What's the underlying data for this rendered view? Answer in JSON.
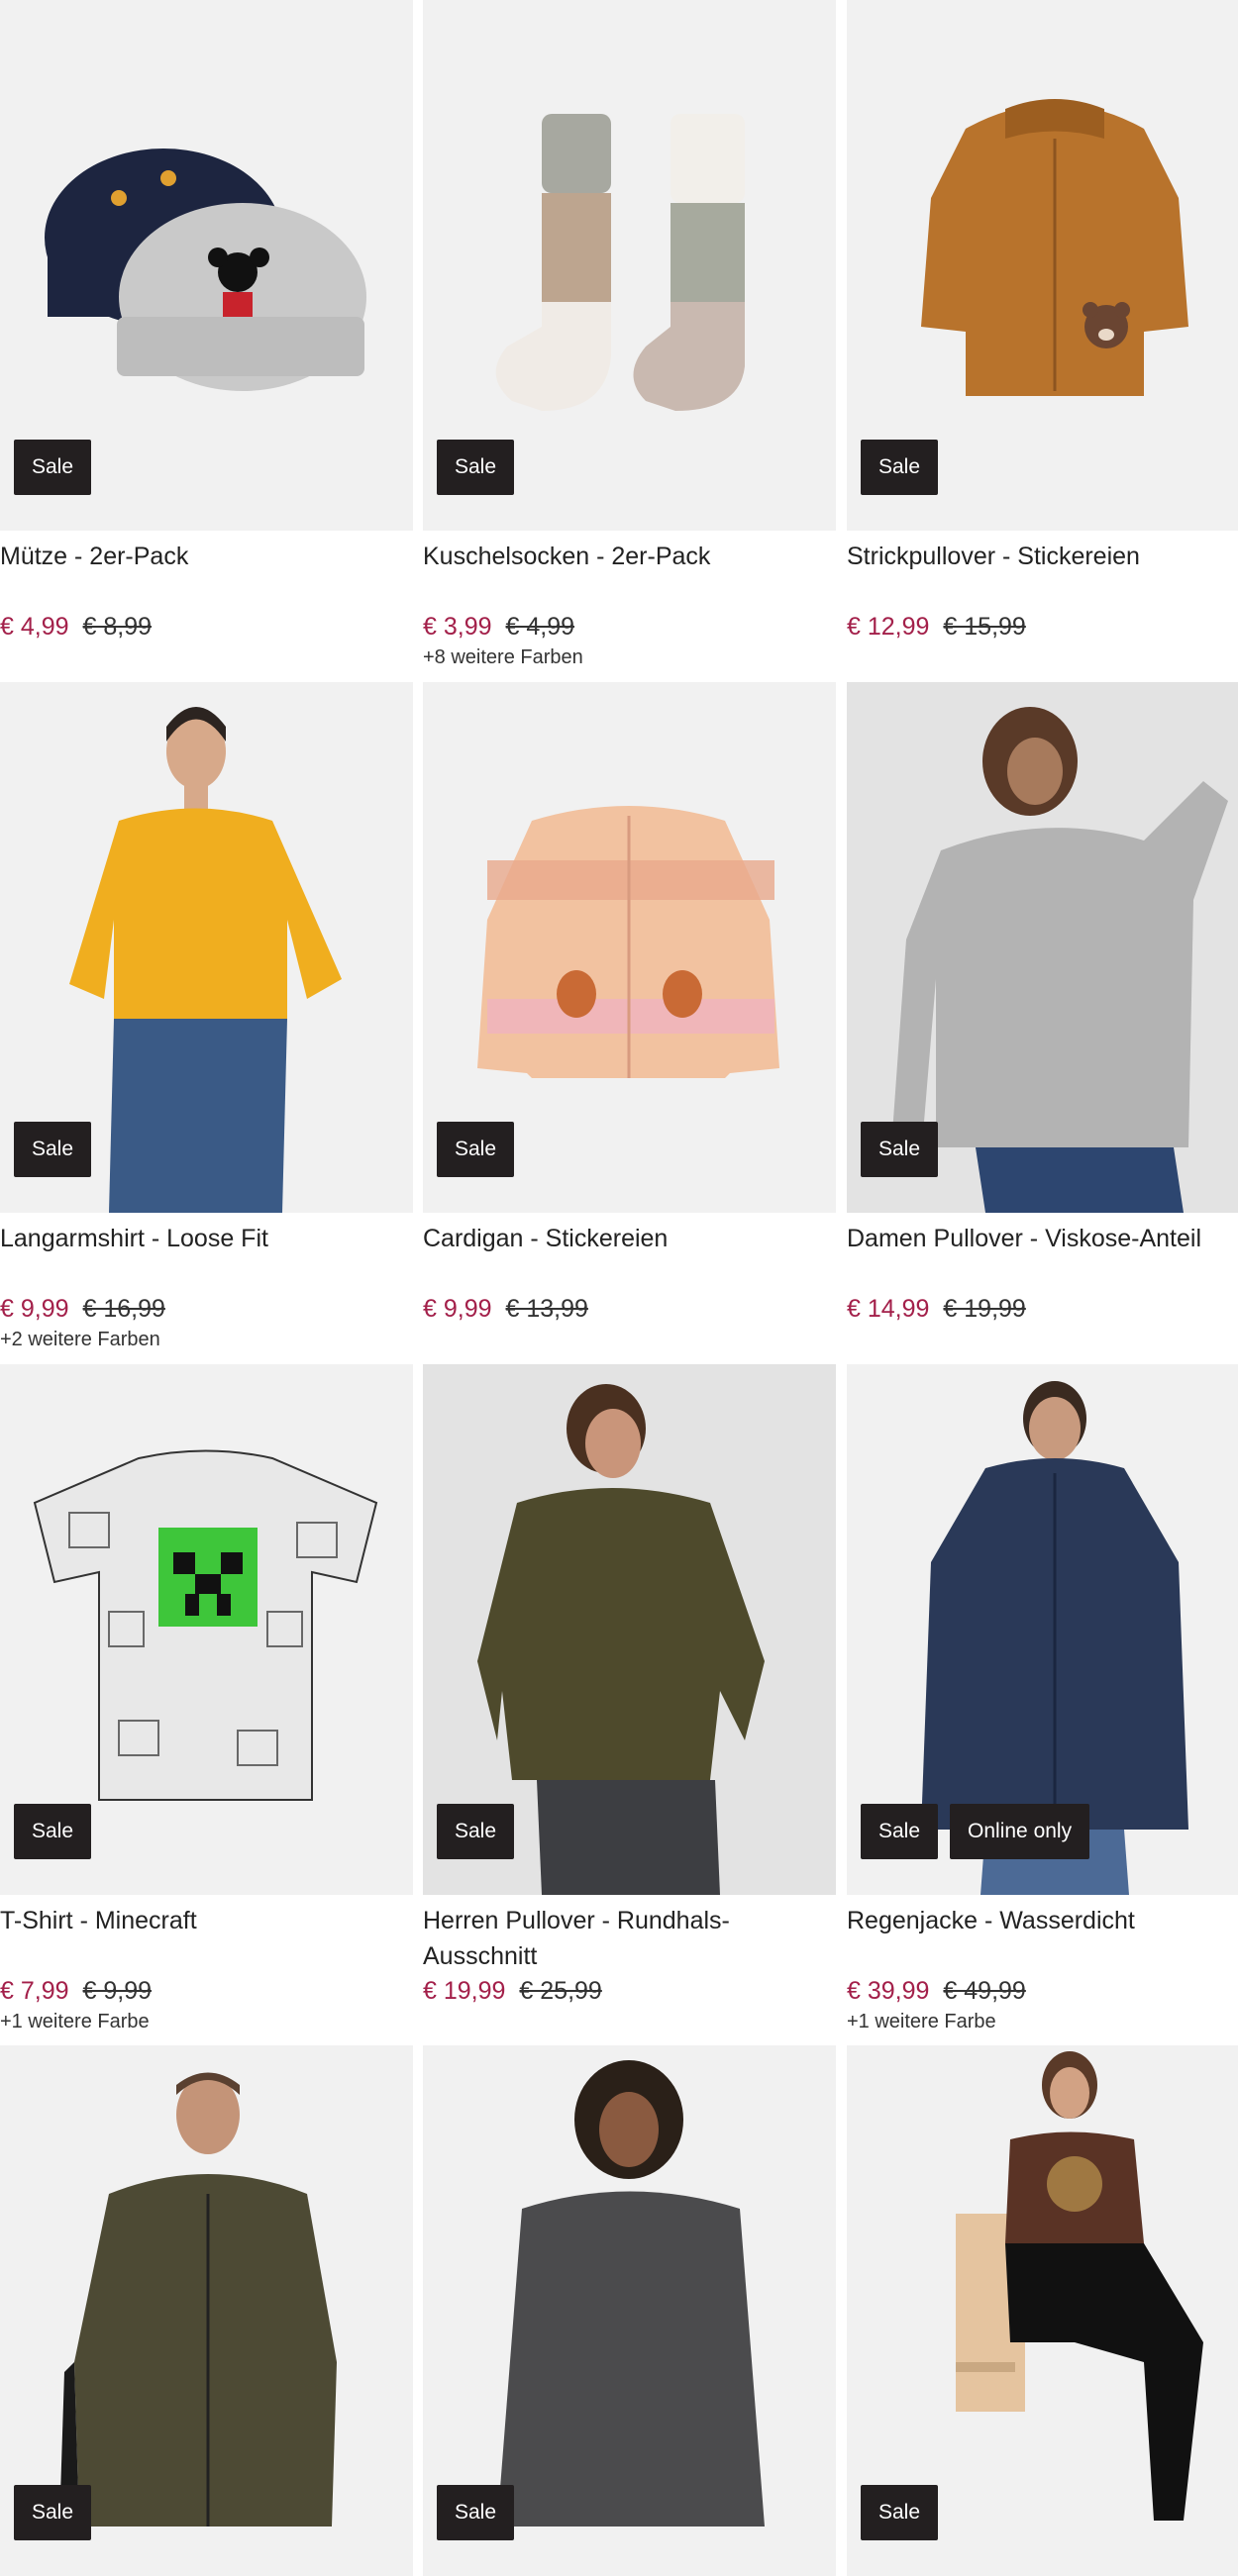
{
  "products": [
    {
      "name": "Mütze - 2er-Pack",
      "price": "€ 4,99",
      "old_price": "€ 8,99",
      "colors": "",
      "badges": [
        "Sale"
      ]
    },
    {
      "name": "Kuschelsocken - 2er-Pack",
      "price": "€ 3,99",
      "old_price": "€ 4,99",
      "colors": "+8 weitere Farben",
      "badges": [
        "Sale"
      ]
    },
    {
      "name": "Strickpullover - Stickereien",
      "price": "€ 12,99",
      "old_price": "€ 15,99",
      "colors": "",
      "badges": [
        "Sale"
      ]
    },
    {
      "name": "Langarmshirt - Loose Fit",
      "price": "€ 9,99",
      "old_price": "€ 16,99",
      "colors": "+2 weitere Farben",
      "badges": [
        "Sale"
      ]
    },
    {
      "name": "Cardigan - Stickereien",
      "price": "€ 9,99",
      "old_price": "€ 13,99",
      "colors": "",
      "badges": [
        "Sale"
      ]
    },
    {
      "name": "Damen Pullover - Viskose-Anteil",
      "price": "€ 14,99",
      "old_price": "€ 19,99",
      "colors": "",
      "badges": [
        "Sale"
      ]
    },
    {
      "name": "T-Shirt - Minecraft",
      "price": "€ 7,99",
      "old_price": "€ 9,99",
      "colors": "+1 weitere Farbe",
      "badges": [
        "Sale"
      ]
    },
    {
      "name": "Herren Pullover - Rundhals-Ausschnitt",
      "price": "€ 19,99",
      "old_price": "€ 25,99",
      "colors": "",
      "badges": [
        "Sale"
      ]
    },
    {
      "name": "Regenjacke - Wasserdicht",
      "price": "€ 39,99",
      "old_price": "€ 49,99",
      "colors": "+1 weitere Farbe",
      "badges": [
        "Sale",
        "Online only"
      ]
    },
    {
      "name": "",
      "price": "",
      "old_price": "",
      "colors": "",
      "badges": [
        "Sale"
      ]
    },
    {
      "name": "",
      "price": "",
      "old_price": "",
      "colors": "",
      "badges": [
        "Sale"
      ]
    },
    {
      "name": "",
      "price": "",
      "old_price": "",
      "colors": "",
      "badges": [
        "Sale"
      ]
    }
  ],
  "colors": {
    "price": "#a3204a",
    "badge_bg": "#231f20",
    "image_bg": "#f1f1f1"
  }
}
